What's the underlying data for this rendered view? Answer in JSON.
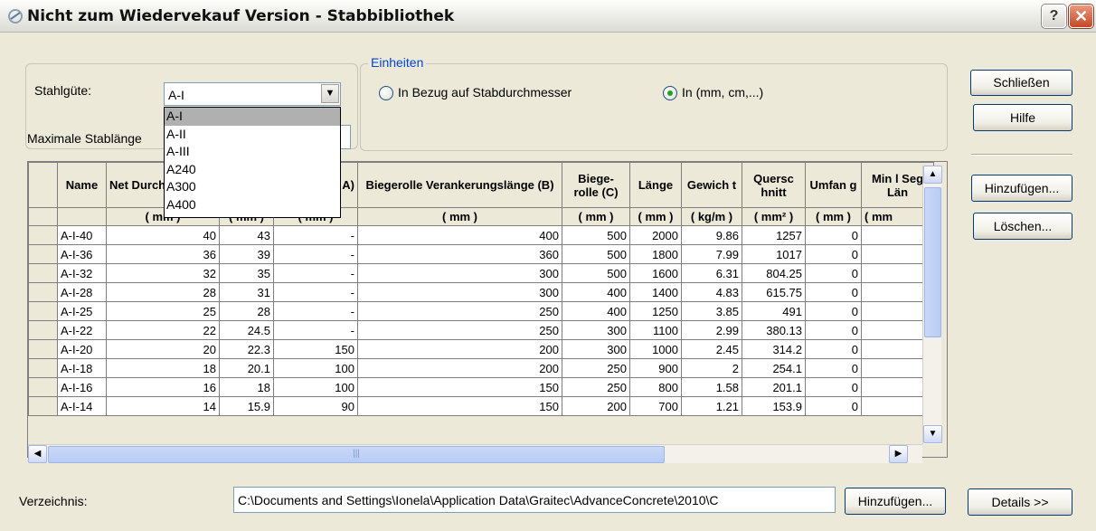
{
  "window": {
    "title": "Nicht zum Wiedervekauf Version - Stabbibliothek",
    "help_label": "?",
    "close_label": "✕"
  },
  "steel": {
    "label": "Stahlgüte:",
    "selected": "A-I",
    "options": [
      "A-I",
      "A-II",
      "A-III",
      "A240",
      "A300",
      "A400"
    ],
    "max_length_label": "Maximale Stablänge"
  },
  "units": {
    "legend": "Einheiten",
    "option_relative": "In Bezug auf Stabdurchmesser",
    "option_absolute": "In (mm, cm,...)",
    "selected": "absolute"
  },
  "table": {
    "headers": [
      "Name",
      "Net Durchm",
      "",
      "lle A)",
      "Biegerolle Verankerungslänge (B)",
      "Biege- rolle (C)",
      "Länge",
      "Gewich t",
      "Quersc hnitt",
      "Umfan g",
      "Min l Seg Län"
    ],
    "units": [
      "",
      "( mm )",
      "( mm )",
      "( mm )",
      "( mm )",
      "( mm )",
      "( mm )",
      "( kg/m )",
      "( mm² )",
      "( mm )",
      "( mm"
    ],
    "rows": [
      [
        "A-I-40",
        "40",
        "43",
        "-",
        "400",
        "500",
        "2000",
        "9.86",
        "1257",
        "0",
        ""
      ],
      [
        "A-I-36",
        "36",
        "39",
        "-",
        "360",
        "500",
        "1800",
        "7.99",
        "1017",
        "0",
        ""
      ],
      [
        "A-I-32",
        "32",
        "35",
        "-",
        "300",
        "500",
        "1600",
        "6.31",
        "804.25",
        "0",
        ""
      ],
      [
        "A-I-28",
        "28",
        "31",
        "-",
        "300",
        "400",
        "1400",
        "4.83",
        "615.75",
        "0",
        ""
      ],
      [
        "A-I-25",
        "25",
        "28",
        "-",
        "250",
        "400",
        "1250",
        "3.85",
        "491",
        "0",
        ""
      ],
      [
        "A-I-22",
        "22",
        "24.5",
        "-",
        "250",
        "300",
        "1100",
        "2.99",
        "380.13",
        "0",
        ""
      ],
      [
        "A-I-20",
        "20",
        "22.3",
        "150",
        "200",
        "300",
        "1000",
        "2.45",
        "314.2",
        "0",
        ""
      ],
      [
        "A-I-18",
        "18",
        "20.1",
        "100",
        "200",
        "250",
        "900",
        "2",
        "254.1",
        "0",
        ""
      ],
      [
        "A-I-16",
        "16",
        "18",
        "100",
        "150",
        "250",
        "800",
        "1.58",
        "201.1",
        "0",
        ""
      ],
      [
        "A-I-14",
        "14",
        "15.9",
        "90",
        "150",
        "200",
        "700",
        "1.21",
        "153.9",
        "0",
        ""
      ]
    ]
  },
  "buttons": {
    "close": "Schließen",
    "help": "Hilfe",
    "add": "Hinzufügen...",
    "delete": "Löschen...",
    "dir_add": "Hinzufügen...",
    "details": "Details >>"
  },
  "directory": {
    "label": "Verzeichnis:",
    "path": "C:\\Documents and Settings\\Ionela\\Application Data\\Graitec\\AdvanceConcrete\\2010\\C"
  },
  "scroll": {
    "up": "▲",
    "down": "▼",
    "left": "◀",
    "right": "▶",
    "grip": "|||"
  }
}
